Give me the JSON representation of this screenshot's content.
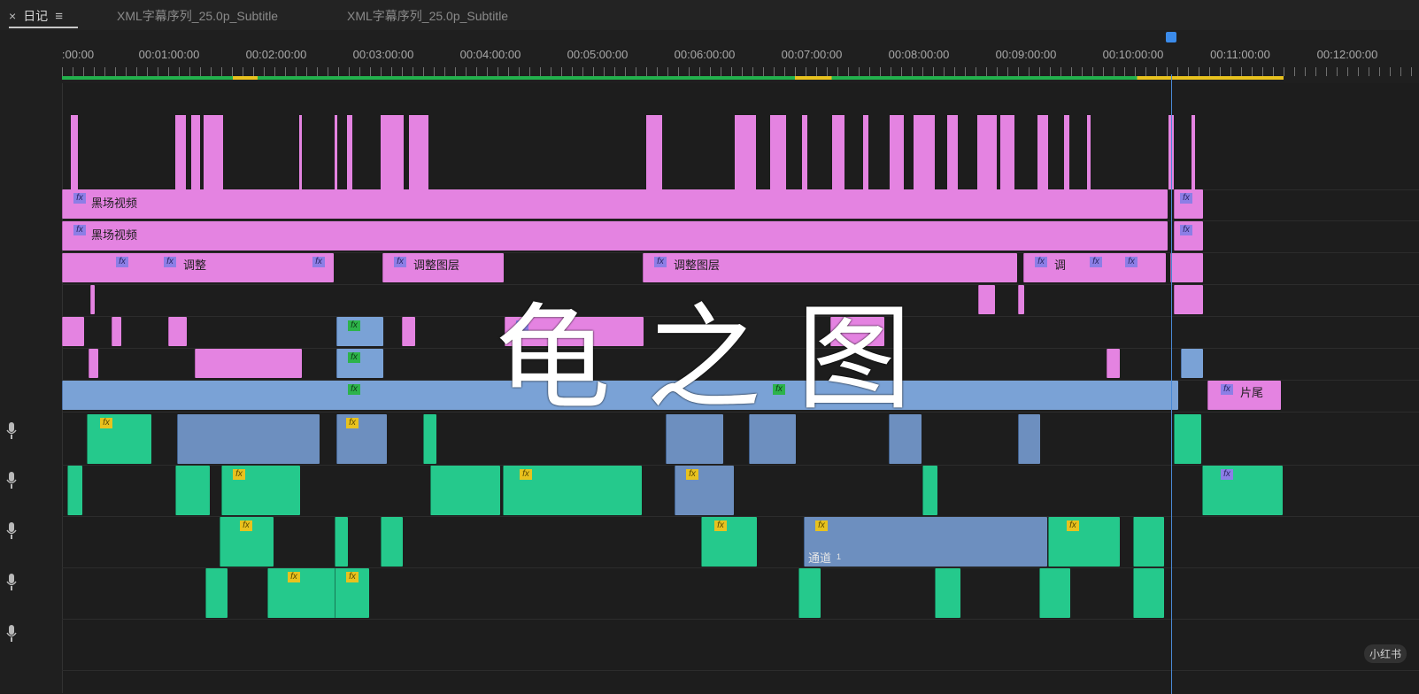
{
  "tabs": [
    {
      "label": "日记",
      "close": "×",
      "menu": "≡"
    },
    {
      "label": "XML字幕序列_25.0p_Subtitle"
    },
    {
      "label": "XML字幕序列_25.0p_Subtitle"
    }
  ],
  "ruler": {
    "timecodes": [
      ":00:00",
      "00:01:00:00",
      "00:02:00:00",
      "00:03:00:00",
      "00:04:00:00",
      "00:05:00:00",
      "00:06:00:00",
      "00:07:00:00",
      "00:08:00:00",
      "00:09:00:00",
      "00:10:00:00",
      "00:11:00:00",
      "00:12:00:00"
    ]
  },
  "clips": {
    "black_video_label": "黑场视频",
    "adjust_short": "调整",
    "adjust_layer": "调整图层",
    "adjust_char": "调",
    "adjust_layer2": "调整图层",
    "adjust_short2": "调整",
    "ending": "片尾",
    "channel": "通道",
    "channel_num": "1",
    "fx": "fx"
  },
  "overlay": {
    "text": "龟之图"
  },
  "watermark": "小红书",
  "colors": {
    "video_clip": "#e483e1",
    "video_blue": "#7aa2d6",
    "audio_clip": "#25c98c",
    "playhead": "#3b8bea"
  }
}
